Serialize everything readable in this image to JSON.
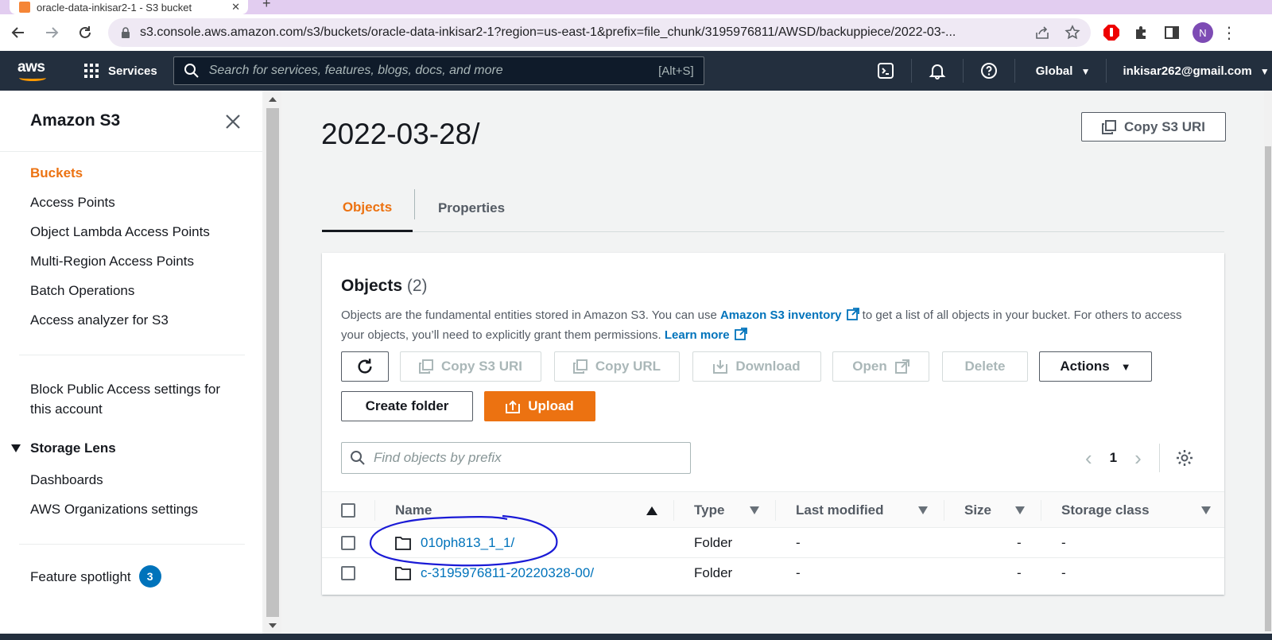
{
  "browser": {
    "tab_title": "oracle-data-inkisar2-1 - S3 bucket",
    "url": "s3.console.aws.amazon.com/s3/buckets/oracle-data-inkisar2-1?region=us-east-1&prefix=file_chunk/3195976811/AWSD/backuppiece/2022-03-...",
    "profile_initial": "N"
  },
  "aws_nav": {
    "logo": "aws",
    "services": "Services",
    "search_placeholder": "Search for services, features, blogs, docs, and more",
    "search_shortcut": "[Alt+S]",
    "region": "Global",
    "account": "inkisar262@gmail.com"
  },
  "sidebar": {
    "title": "Amazon S3",
    "links": [
      "Buckets",
      "Access Points",
      "Object Lambda Access Points",
      "Multi-Region Access Points",
      "Batch Operations",
      "Access analyzer for S3"
    ],
    "block_public_access": "Block Public Access settings for this account",
    "storage_lens": "Storage Lens",
    "storage_lens_links": [
      "Dashboards",
      "AWS Organizations settings"
    ],
    "feature_spotlight": "Feature spotlight",
    "feature_spotlight_count": "3"
  },
  "main": {
    "title": "2022-03-28/",
    "copy_s3_uri": "Copy S3 URI",
    "tabs": [
      "Objects",
      "Properties"
    ],
    "objects": {
      "title": "Objects",
      "count": "(2)",
      "desc_1": "Objects are the fundamental entities stored in Amazon S3. You can use ",
      "desc_link1": "Amazon S3 inventory",
      "desc_2": " to get a list of all objects in your bucket. For others to access your objects, you’ll need to explicitly grant them permissions. ",
      "desc_link2": "Learn more",
      "buttons": {
        "copy_s3_uri": "Copy S3 URI",
        "copy_url": "Copy URL",
        "download": "Download",
        "open": "Open",
        "delete": "Delete",
        "actions": "Actions",
        "create_folder": "Create folder",
        "upload": "Upload"
      },
      "search_placeholder": "Find objects by prefix",
      "page": "1",
      "columns": [
        "Name",
        "Type",
        "Last modified",
        "Size",
        "Storage class"
      ],
      "rows": [
        {
          "name": "010ph813_1_1/",
          "type": "Folder",
          "last_modified": "-",
          "size": "-",
          "storage_class": "-"
        },
        {
          "name": "c-3195976811-20220328-00/",
          "type": "Folder",
          "last_modified": "-",
          "size": "-",
          "storage_class": "-"
        }
      ]
    }
  },
  "colors": {
    "aws_nav": "#232f3e",
    "accent_orange": "#ec7211",
    "link_blue": "#0073bb",
    "annotation": "#1a1ad6"
  }
}
